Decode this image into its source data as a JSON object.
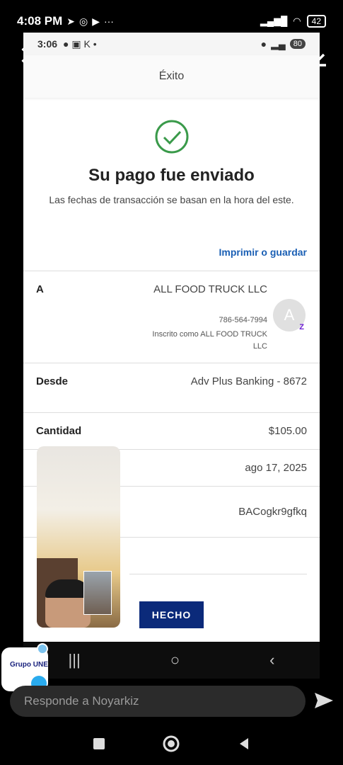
{
  "outer_status": {
    "time": "4:08 PM",
    "battery": "42"
  },
  "inner_status": {
    "time": "3:06",
    "battery": "80"
  },
  "header": {
    "title": "Éxito"
  },
  "success": {
    "title": "Su pago fue enviado",
    "subtitle": "Las fechas de transacción se basan en la hora del este.",
    "print_link": "Imprimir o guardar"
  },
  "recipient": {
    "label": "A",
    "name": "ALL FOOD TRUCK LLC",
    "phone": "786-564-7994",
    "enrolled": "Inscrito como ALL FOOD TRUCK LLC",
    "avatar_letter": "A",
    "zelle_mark": "Z"
  },
  "from": {
    "label": "Desde",
    "value": "Adv Plus Banking - 8672"
  },
  "amount": {
    "label": "Cantidad",
    "value": "$105.00"
  },
  "date": {
    "value": "ago 17, 2025"
  },
  "confirmation": {
    "value": "BACogkr9gfkq"
  },
  "done_button": "HECHO",
  "sticker": {
    "text": "Grupo UNE"
  },
  "reply": {
    "placeholder": "Responde a Noyarkiz"
  },
  "colors": {
    "success_green": "#3a9a4a",
    "link_blue": "#1a5fb4",
    "button_navy": "#0b2a7a"
  }
}
